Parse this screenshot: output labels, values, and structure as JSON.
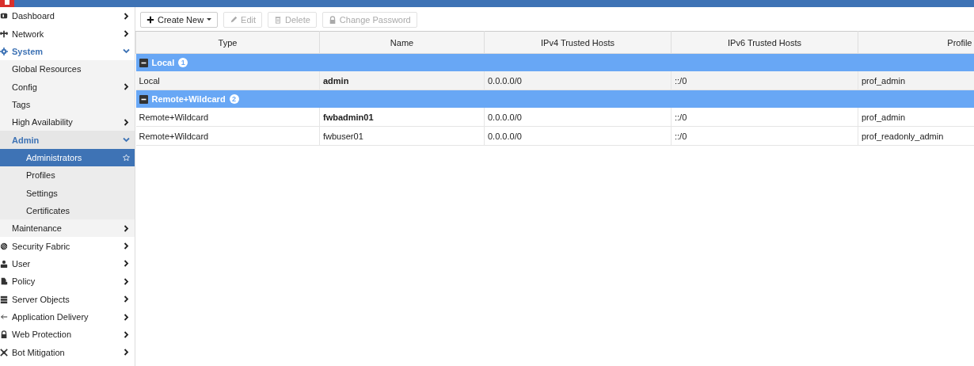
{
  "sidebar": {
    "items": [
      {
        "label": "Dashboard",
        "kind": "group",
        "expanded": false
      },
      {
        "label": "Network",
        "kind": "group",
        "expanded": false
      },
      {
        "label": "System",
        "kind": "group",
        "expanded": true,
        "children": [
          {
            "label": "Global Resources",
            "kind": "link",
            "selected": false
          },
          {
            "label": "Config",
            "kind": "group",
            "expanded": false
          },
          {
            "label": "Tags",
            "kind": "link",
            "selected": false
          },
          {
            "label": "High Availability",
            "kind": "group",
            "expanded": false
          },
          {
            "label": "Admin",
            "kind": "group",
            "expanded": true,
            "children": [
              {
                "label": "Administrators",
                "kind": "link",
                "selected": true
              },
              {
                "label": "Profiles",
                "kind": "link",
                "selected": false
              },
              {
                "label": "Settings",
                "kind": "link",
                "selected": false
              },
              {
                "label": "Certificates",
                "kind": "link",
                "selected": false
              }
            ]
          },
          {
            "label": "Maintenance",
            "kind": "group",
            "expanded": false
          }
        ]
      },
      {
        "label": "Security Fabric",
        "kind": "group",
        "expanded": false
      },
      {
        "label": "User",
        "kind": "group",
        "expanded": false
      },
      {
        "label": "Policy",
        "kind": "group",
        "expanded": false
      },
      {
        "label": "Server Objects",
        "kind": "group",
        "expanded": false
      },
      {
        "label": "Application Delivery",
        "kind": "group",
        "expanded": false
      },
      {
        "label": "Web Protection",
        "kind": "group",
        "expanded": false
      },
      {
        "label": "Bot Mitigation",
        "kind": "group",
        "expanded": false
      }
    ]
  },
  "toolbar": {
    "buttons": [
      {
        "label": "Create New",
        "disabled": false,
        "dropdown": true
      },
      {
        "label": "Edit",
        "disabled": true,
        "dropdown": false
      },
      {
        "label": "Delete",
        "disabled": true,
        "dropdown": false
      },
      {
        "label": "Change Password",
        "disabled": true,
        "dropdown": false
      }
    ]
  },
  "table": {
    "columns": [
      "Type",
      "Name",
      "IPv4 Trusted Hosts",
      "IPv6 Trusted Hosts",
      "Profile"
    ],
    "groups": [
      {
        "label": "Local",
        "count": "1",
        "expanded": true,
        "rows": [
          {
            "cells": [
              "Local",
              "admin",
              "0.0.0.0/0",
              "::/0",
              "prof_admin"
            ],
            "bold_name": true,
            "highlighted": true
          }
        ]
      },
      {
        "label": "Remote+Wildcard",
        "count": "2",
        "expanded": true,
        "rows": [
          {
            "cells": [
              "Remote+Wildcard",
              "fwbadmin01",
              "0.0.0.0/0",
              "::/0",
              "prof_admin"
            ],
            "bold_name": true,
            "highlighted": false
          },
          {
            "cells": [
              "Remote+Wildcard",
              "fwbuser01",
              "0.0.0.0/0",
              "::/0",
              "prof_readonly_admin"
            ],
            "bold_name": false,
            "highlighted": false
          }
        ]
      }
    ]
  }
}
